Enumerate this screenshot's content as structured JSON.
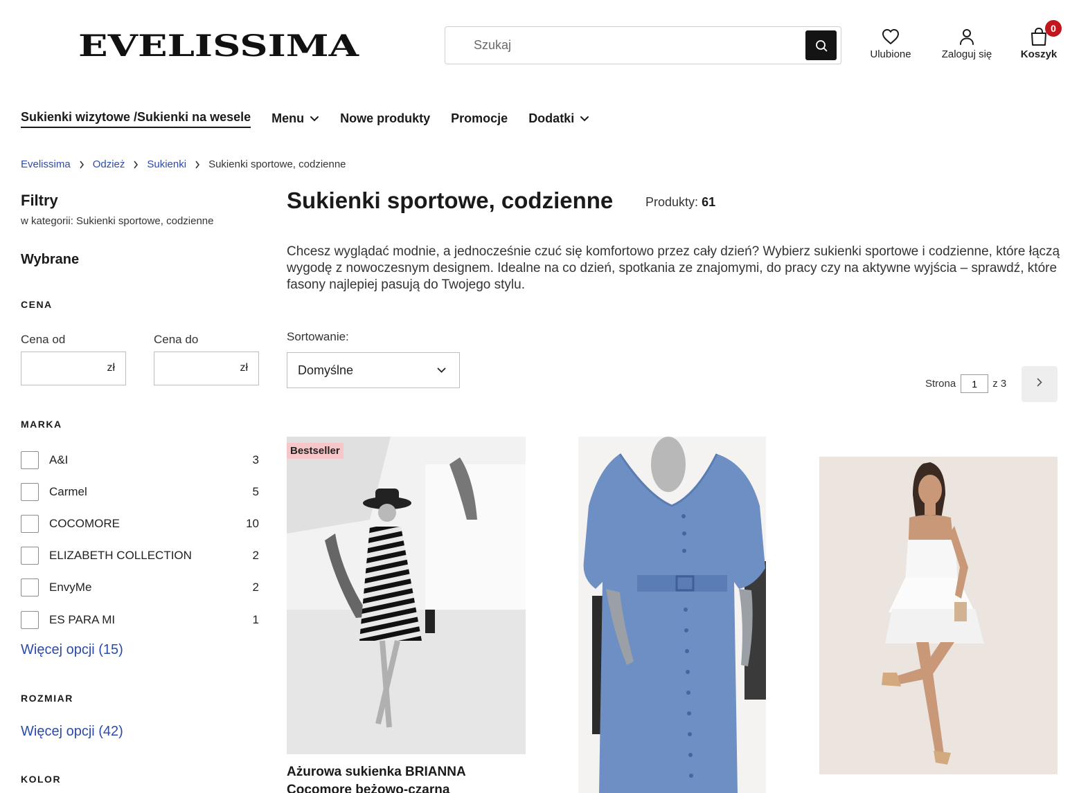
{
  "header": {
    "logo_text": "EVELISSIMA",
    "search_placeholder": "Szukaj",
    "favorites_label": "Ulubione",
    "login_label": "Zaloguj się",
    "cart_label": "Koszyk",
    "cart_count": "0"
  },
  "nav": {
    "items": [
      {
        "label": "Sukienki wizytowe /Sukienki na wesele",
        "active": true
      },
      {
        "label": "Menu",
        "dropdown": true
      },
      {
        "label": "Nowe produkty"
      },
      {
        "label": "Promocje"
      },
      {
        "label": "Dodatki",
        "dropdown": true
      }
    ]
  },
  "breadcrumb": [
    "Evelissima",
    "Odzież",
    "Sukienki",
    "Sukienki sportowe, codzienne"
  ],
  "sidebar": {
    "title": "Filtry",
    "subtitle": "w kategorii: Sukienki sportowe, codzienne",
    "selected_heading": "Wybrane",
    "price": {
      "heading": "CENA",
      "from_label": "Cena od",
      "to_label": "Cena do",
      "currency": "zł"
    },
    "brand": {
      "heading": "MARKA",
      "items": [
        {
          "name": "A&I",
          "count": "3"
        },
        {
          "name": "Carmel",
          "count": "5"
        },
        {
          "name": "COCOMORE",
          "count": "10"
        },
        {
          "name": "ELIZABETH COLLECTION",
          "count": "2"
        },
        {
          "name": "EnvyMe",
          "count": "2"
        },
        {
          "name": "ES PARA MI",
          "count": "1"
        }
      ],
      "more": "Więcej opcji (15)"
    },
    "size": {
      "heading": "ROZMIAR",
      "more": "Więcej opcji (42)"
    },
    "color": {
      "heading": "KOLOR"
    }
  },
  "main": {
    "title": "Sukienki sportowe, codzienne",
    "products_label": "Produkty:",
    "products_count": "61",
    "description": "Chcesz wyglądać modnie, a jednocześnie czuć się komfortowo przez cały dzień? Wybierz sukienki sportowe i codzienne, które łączą wygodę z nowoczesnym designem. Idealne na co dzień, spotkania ze znajomymi, do pracy czy na aktywne wyjścia – sprawdź, które fasony najlepiej pasują do Twojego stylu.",
    "sort_label": "Sortowanie:",
    "sort_value": "Domyślne",
    "pager": {
      "prefix": "Strona",
      "current": "1",
      "suffix": "z 3"
    }
  },
  "products": [
    {
      "badge": "Bestseller",
      "title": "Ażurowa sukienka BRIANNA Cocomore beżowo-czarna"
    },
    {
      "title": ""
    },
    {
      "title": ""
    }
  ]
}
